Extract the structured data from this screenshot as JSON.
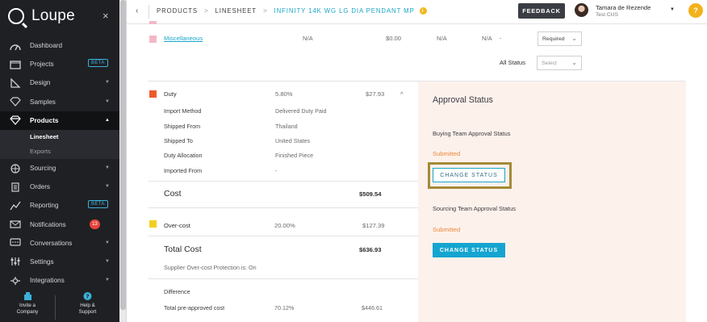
{
  "app": {
    "brand": "Loupe",
    "close_glyph": "×"
  },
  "sidebar": {
    "items": [
      {
        "label": "Dashboard",
        "icon": "dashboard-icon"
      },
      {
        "label": "Projects",
        "icon": "projects-icon",
        "badge": "BETA"
      },
      {
        "label": "Design",
        "icon": "design-icon",
        "caret": "▼"
      },
      {
        "label": "Samples",
        "icon": "samples-icon",
        "caret": "▼"
      },
      {
        "label": "Products",
        "icon": "products-icon",
        "caret": "▲"
      },
      {
        "label": "Sourcing",
        "icon": "sourcing-icon",
        "caret": "▼"
      },
      {
        "label": "Orders",
        "icon": "orders-icon",
        "caret": "▼"
      },
      {
        "label": "Reporting",
        "icon": "reporting-icon",
        "badge": "BETA"
      },
      {
        "label": "Notifications",
        "icon": "notifications-icon",
        "count": "13"
      },
      {
        "label": "Conversations",
        "icon": "conversations-icon",
        "caret": "▼"
      },
      {
        "label": "Settings",
        "icon": "settings-icon",
        "caret": "▼"
      },
      {
        "label": "Integrations",
        "icon": "integrations-icon",
        "caret": "▼"
      }
    ],
    "subitems": [
      {
        "label": "Linesheet"
      },
      {
        "label": "Exports"
      }
    ],
    "footer": {
      "invite_line1": "Invite a",
      "invite_line2": "Company",
      "help_line1": "Help &",
      "help_line2": "Support"
    }
  },
  "topbar": {
    "back_glyph": "‹",
    "crumbs": [
      "PRODUCTS",
      "LINESHEET",
      "INFINITY 14K WG LG DIA PENDANT MP"
    ],
    "crumb_sep": ">",
    "feedback": "FEEDBACK",
    "user_name": "Tamara de Rezende",
    "user_org": "Test CUS",
    "user_caret": "▼",
    "help": "?"
  },
  "misc_row": {
    "label": "Miscellaneous",
    "c1": "N/A",
    "c2": "$0.00",
    "c3": "N/A",
    "c4": "N/A",
    "c5": "-",
    "select": "Required",
    "swatch_color": "#f2b8c6"
  },
  "all_status": {
    "label": "All Status",
    "select_placeholder": "Select"
  },
  "duty": {
    "label": "Duty",
    "percent": "5.80%",
    "amount": "$27.93",
    "caret": "^",
    "swatch_color": "#ec5a2a",
    "details": [
      {
        "k": "Import Method",
        "v": "Delivered Duty Paid"
      },
      {
        "k": "Shipped From",
        "v": "Thailand"
      },
      {
        "k": "Shipped To",
        "v": "United States"
      },
      {
        "k": "Duty Allocation",
        "v": "Finished Piece"
      },
      {
        "k": "Imported From",
        "v": "-"
      }
    ]
  },
  "cost": {
    "label": "Cost",
    "value": "$509.54"
  },
  "overcost": {
    "label": "Over-cost",
    "percent": "20.00%",
    "amount": "$127.39",
    "swatch_color": "#f2cf1f"
  },
  "total_cost": {
    "label": "Total Cost",
    "value": "$636.93",
    "note": "Supplier Over-cost Protection is: On"
  },
  "difference": {
    "label": "Difference",
    "row_label": "Total pre-approved cost",
    "percent": "70.12%",
    "amount": "$446.61"
  },
  "approval": {
    "title": "Approval Status",
    "buying_label": "Buying Team Approval Status",
    "buying_status": "Submitted",
    "buying_button": "CHANGE STATUS",
    "sourcing_label": "Sourcing Team Approval Status",
    "sourcing_status": "Submitted",
    "sourcing_button": "CHANGE STATUS"
  }
}
